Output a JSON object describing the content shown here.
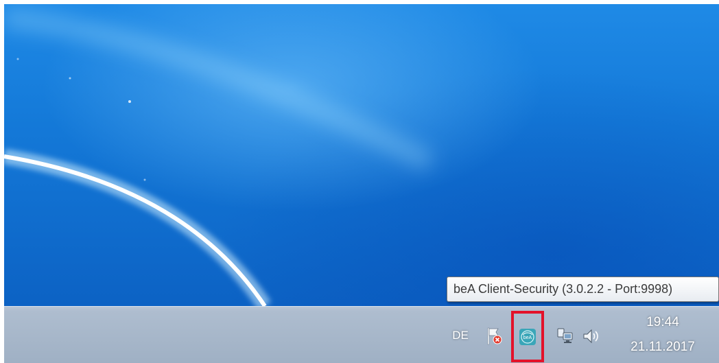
{
  "desktop": {
    "wallpaper": "windows-7-default-blue"
  },
  "tooltip": {
    "text": "beA Client-Security (3.0.2.2 - Port:9998)"
  },
  "taskbar": {
    "tray": {
      "language": "DE",
      "icons": [
        {
          "name": "action-center-flag-icon",
          "status": "error"
        },
        {
          "name": "bea-client-security-icon",
          "label": "beA",
          "highlighted": true,
          "highlight_color": "#e3122a"
        },
        {
          "name": "network-icon"
        },
        {
          "name": "volume-icon"
        }
      ],
      "clock": {
        "time": "19:44",
        "date": "21.11.2017"
      }
    }
  },
  "colors": {
    "desktop_blue": "#1479d8",
    "taskbar": "#aebdcf",
    "highlight": "#e3122a"
  }
}
